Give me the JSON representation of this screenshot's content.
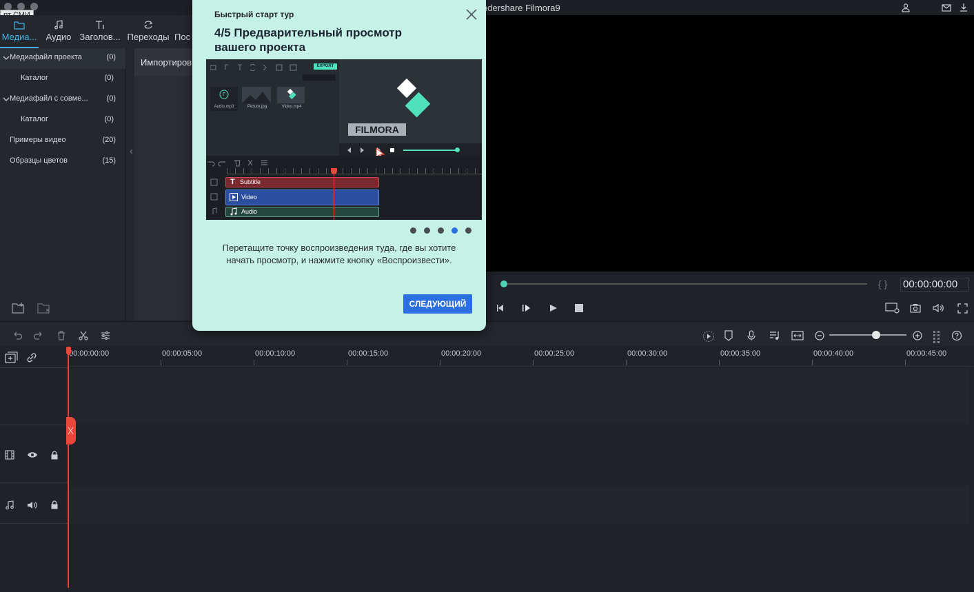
{
  "window": {
    "title": "ndershare Filmora9",
    "tooltip": "рт СМИ"
  },
  "media_tabs": [
    {
      "label": "Медиа..."
    },
    {
      "label": "Аудио"
    },
    {
      "label": "Заголов..."
    },
    {
      "label": "Переходы"
    },
    {
      "label": "Пос"
    }
  ],
  "library": [
    {
      "label": "Медиафайл проекта",
      "count": "(0)"
    },
    {
      "label": "Каталог",
      "count": "(0)"
    },
    {
      "label": "Медиафайл с совме...",
      "count": "(0)"
    },
    {
      "label": "Каталог",
      "count": "(0)"
    },
    {
      "label": "Примеры видео",
      "count": "(20)"
    },
    {
      "label": "Образцы цветов",
      "count": "(15)"
    }
  ],
  "import_label": "Импортиров",
  "player": {
    "timecode": "00:00:00:00",
    "in_out": "{ }",
    "progress": 0
  },
  "timeline": {
    "ruler": [
      "00:00:00:00",
      "00:00:05:00",
      "00:00:10:00",
      "00:00:15:00",
      "00:00:20:00",
      "00:00:25:00",
      "00:00:30:00",
      "00:00:35:00",
      "00:00:40:00",
      "00:00:45:00"
    ],
    "zoom_level": 0.55
  },
  "tour": {
    "kicker": "Быстрый старт тур",
    "title": "4/5 Предварительный просмотр вашего проекта",
    "description": "Перетащите точку воспроизведения туда, где вы хотите начать просмотр, и нажмите кнопку «Воспроизвести».",
    "next_label": "СЛЕДУЮЩИЙ",
    "step": 4,
    "total_steps": 5,
    "image": {
      "export_badge": "EXPORT",
      "brand": "FILMORA",
      "files": [
        "Audio.mp3",
        "Picture.jpg",
        "Video.mp4"
      ],
      "tracks": [
        "Subtitle",
        "Video",
        "Audio"
      ]
    }
  },
  "colors": {
    "accent": "#3fb4e8",
    "playhead": "#e8473b",
    "scrub": "#4fd2b5",
    "tour_bg": "#c6f1e7",
    "button": "#2b6fe0"
  }
}
